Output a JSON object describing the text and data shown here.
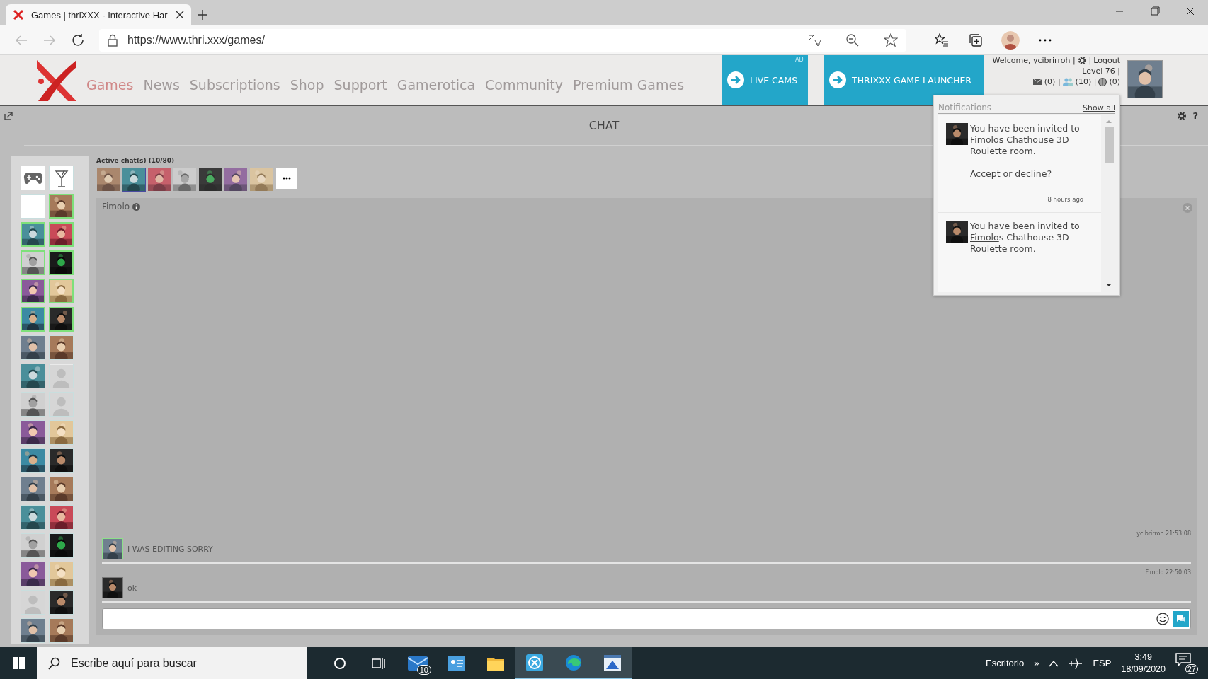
{
  "browser": {
    "tab": {
      "title": "Games | thriXXX - Interactive Har",
      "selected": true
    },
    "url": "https://www.thri.xxx/games/"
  },
  "site_header": {
    "nav": [
      {
        "label": "Games",
        "selected": true
      },
      {
        "label": "News",
        "selected": false
      },
      {
        "label": "Subscriptions",
        "selected": false
      },
      {
        "label": "Shop",
        "selected": false
      },
      {
        "label": "Support",
        "selected": false
      },
      {
        "label": "Gamerotica",
        "selected": false
      },
      {
        "label": "Community",
        "selected": false
      },
      {
        "label": "Premium Games",
        "selected": false
      }
    ],
    "promos": [
      {
        "label": "LIVE CAMS",
        "ad": "AD"
      },
      {
        "label": "THRIXXX GAME LAUNCHER"
      }
    ],
    "user": {
      "welcome": "Welcome, ycibrirroh |",
      "sep": "|",
      "logout": "Logout",
      "level": "Level 76 |",
      "messages": "(0) |",
      "friends": "(10) |",
      "world": "(0)"
    }
  },
  "notifications": {
    "title": "Notifications",
    "show_all": "Show all",
    "items": [
      {
        "before": "You have been invited to",
        "link": "Fimolo",
        "after": "s Chathouse 3D Roulette room.",
        "accept": "Accept",
        "or": "or",
        "decline": "decline",
        "suffix": "?",
        "time": "8 hours ago"
      },
      {
        "before": "You have been invited to",
        "link": "Fimolo",
        "after": "s Chathouse 3D Roulette room."
      }
    ]
  },
  "chat": {
    "title": "CHAT",
    "help": "?",
    "contacts": [
      {
        "kind": "gamepad",
        "online": false
      },
      {
        "kind": "cocktail",
        "online": false
      },
      {
        "kind": "blank",
        "online": false
      },
      {
        "kind": "picture",
        "online": true
      },
      {
        "kind": "picture",
        "online": true
      },
      {
        "kind": "picture",
        "online": true
      },
      {
        "kind": "picture",
        "online": true
      },
      {
        "kind": "picture",
        "online": true
      },
      {
        "kind": "picture",
        "online": true
      },
      {
        "kind": "picture",
        "online": true
      },
      {
        "kind": "picture",
        "online": true
      },
      {
        "kind": "picture",
        "online": true
      },
      {
        "kind": "picture",
        "online": false
      },
      {
        "kind": "picture",
        "online": false
      },
      {
        "kind": "picture",
        "online": false
      },
      {
        "kind": "silhouette",
        "online": false
      },
      {
        "kind": "picture",
        "online": false
      },
      {
        "kind": "silhouette",
        "online": false
      },
      {
        "kind": "picture",
        "online": false
      },
      {
        "kind": "picture",
        "online": false
      },
      {
        "kind": "picture",
        "online": false
      },
      {
        "kind": "picture",
        "online": false
      },
      {
        "kind": "picture",
        "online": false
      },
      {
        "kind": "picture",
        "online": false
      },
      {
        "kind": "picture",
        "online": false
      },
      {
        "kind": "picture",
        "online": false
      },
      {
        "kind": "picture",
        "online": false
      },
      {
        "kind": "picture",
        "online": false
      },
      {
        "kind": "picture",
        "online": false
      },
      {
        "kind": "picture",
        "online": false
      },
      {
        "kind": "silhouette",
        "online": false
      },
      {
        "kind": "picture",
        "online": false
      },
      {
        "kind": "picture",
        "online": false
      },
      {
        "kind": "picture",
        "online": false
      }
    ],
    "active_label": "Active chat(s) (10/80)",
    "active_chats": [
      {
        "selected": false
      },
      {
        "selected": true
      },
      {
        "selected": false
      },
      {
        "selected": false
      },
      {
        "selected": false
      },
      {
        "selected": false
      },
      {
        "selected": false
      }
    ],
    "conversation": {
      "name": "Fimolo",
      "messages": [
        {
          "author_time": "ycibrirroh 21:53:08",
          "text": "I WAS EDITING SORRY",
          "online": true
        },
        {
          "author_time": "Fimolo 22:50:03",
          "text": "ok",
          "online": false
        }
      ]
    }
  },
  "taskbar": {
    "search_placeholder": "Escribe aquí para buscar",
    "mail_badge": "10",
    "desktop": "Escritorio",
    "chevron": "»",
    "language": "ESP",
    "time": "3:49",
    "date": "18/09/2020",
    "notifications_badge": "27"
  }
}
